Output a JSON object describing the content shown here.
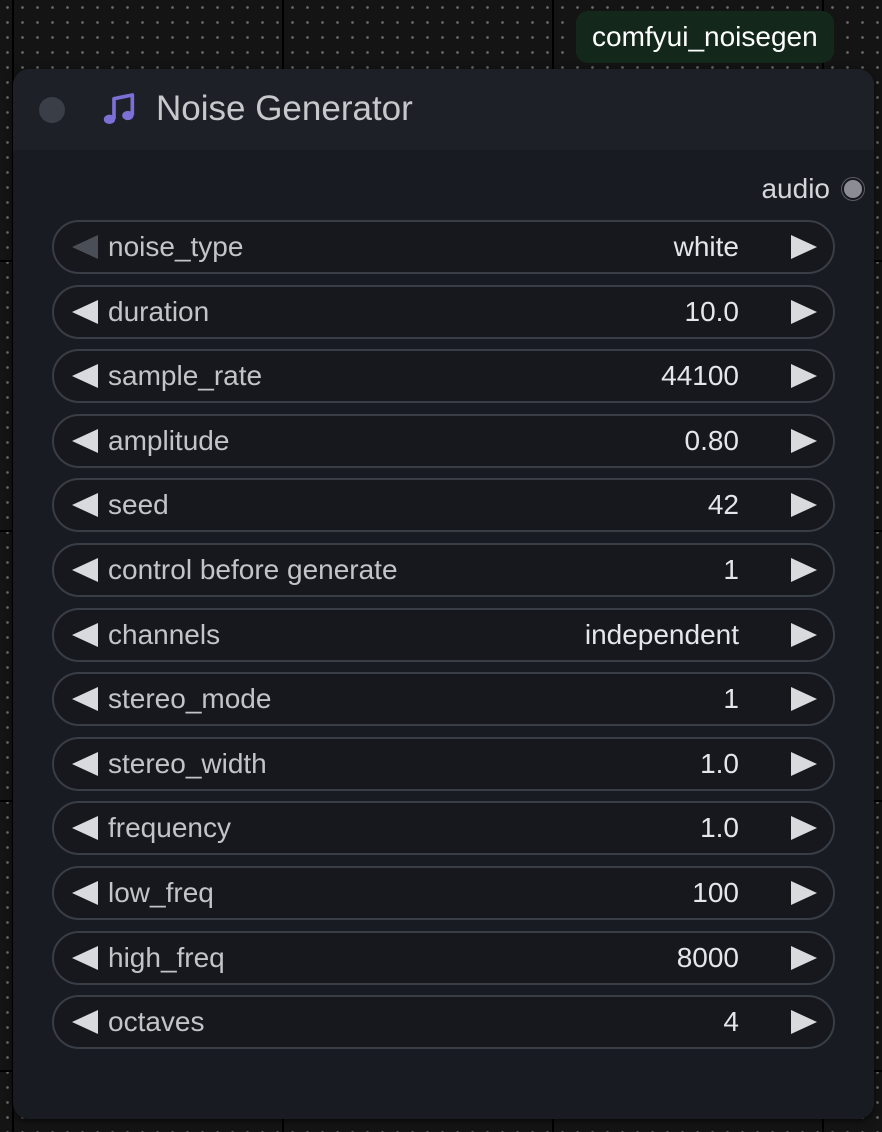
{
  "badge": {
    "label": "comfyui_noisegen"
  },
  "node": {
    "title": "Noise Generator",
    "icon": "music-note-icon",
    "icon_color": "#7c6fd6",
    "output": {
      "label": "audio"
    }
  },
  "widgets": [
    {
      "name": "noise_type",
      "value": "white",
      "left_disabled": true
    },
    {
      "name": "duration",
      "value": "10.0"
    },
    {
      "name": "sample_rate",
      "value": "44100"
    },
    {
      "name": "amplitude",
      "value": "0.80"
    },
    {
      "name": "seed",
      "value": "42"
    },
    {
      "name": "control before generate",
      "value": "1"
    },
    {
      "name": "channels",
      "value": "independent"
    },
    {
      "name": "stereo_mode",
      "value": "1"
    },
    {
      "name": "stereo_width",
      "value": "1.0"
    },
    {
      "name": "frequency",
      "value": "1.0"
    },
    {
      "name": "low_freq",
      "value": "100"
    },
    {
      "name": "high_freq",
      "value": "8000"
    },
    {
      "name": "octaves",
      "value": "4"
    }
  ]
}
